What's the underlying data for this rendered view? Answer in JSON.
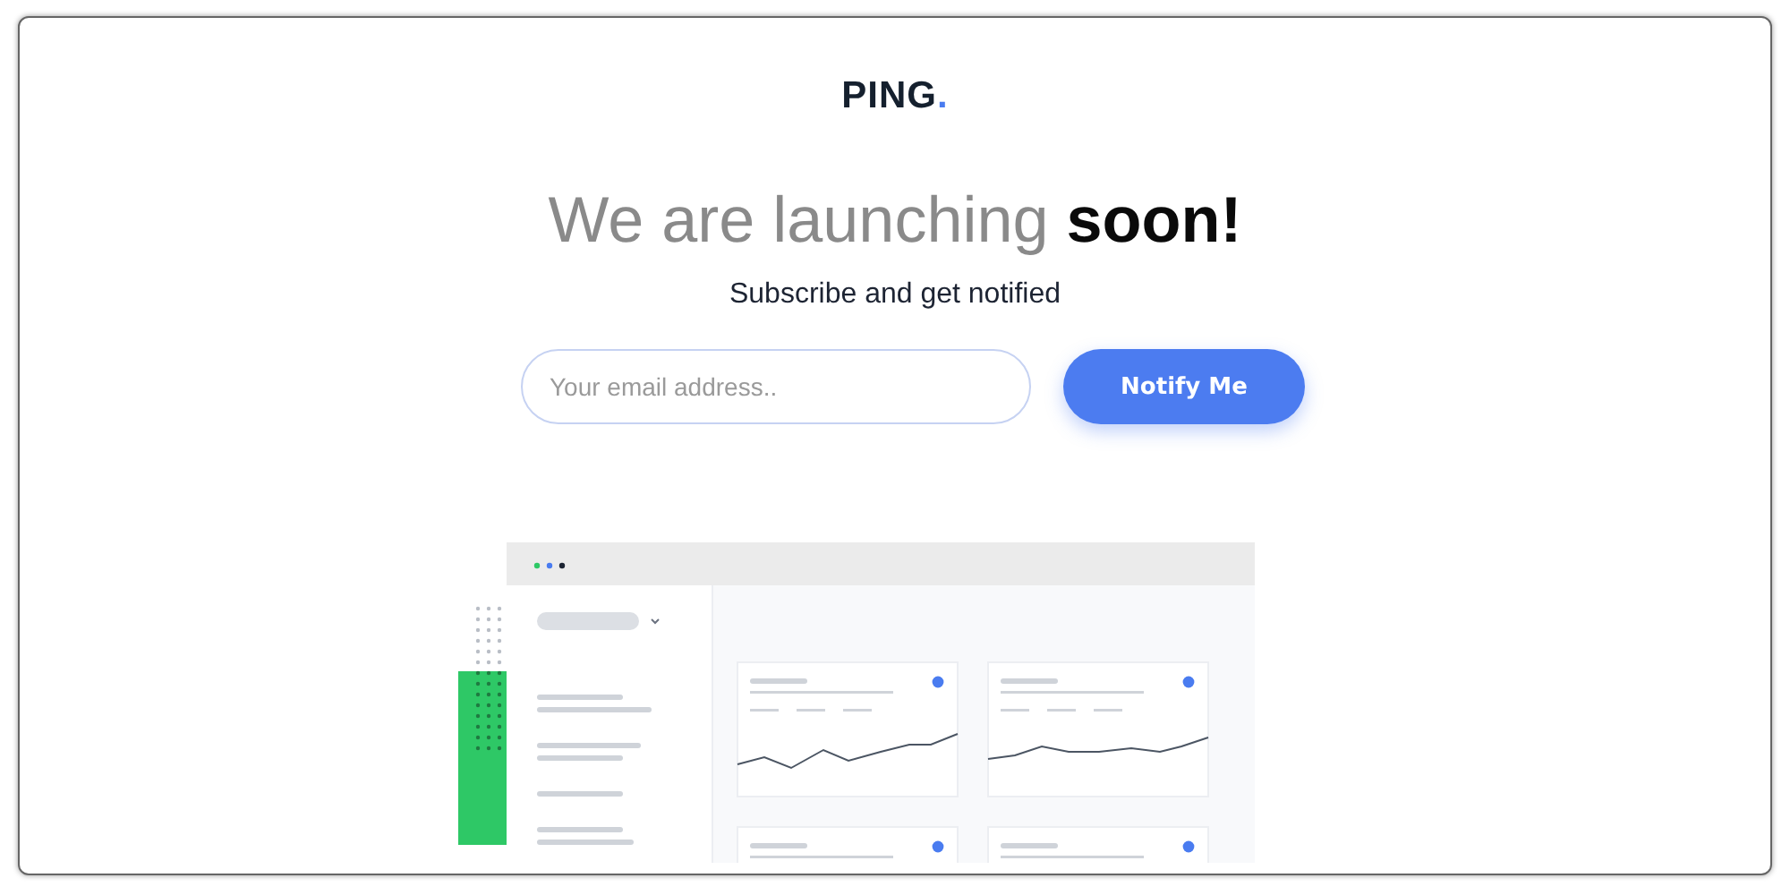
{
  "logo": {
    "text": "PING",
    "dot": "."
  },
  "headline": "We are launching **soon!**",
  "subtitle": "Subscribe and get notified",
  "form": {
    "placeholder": "Your email address..",
    "button": "Notify Me"
  }
}
